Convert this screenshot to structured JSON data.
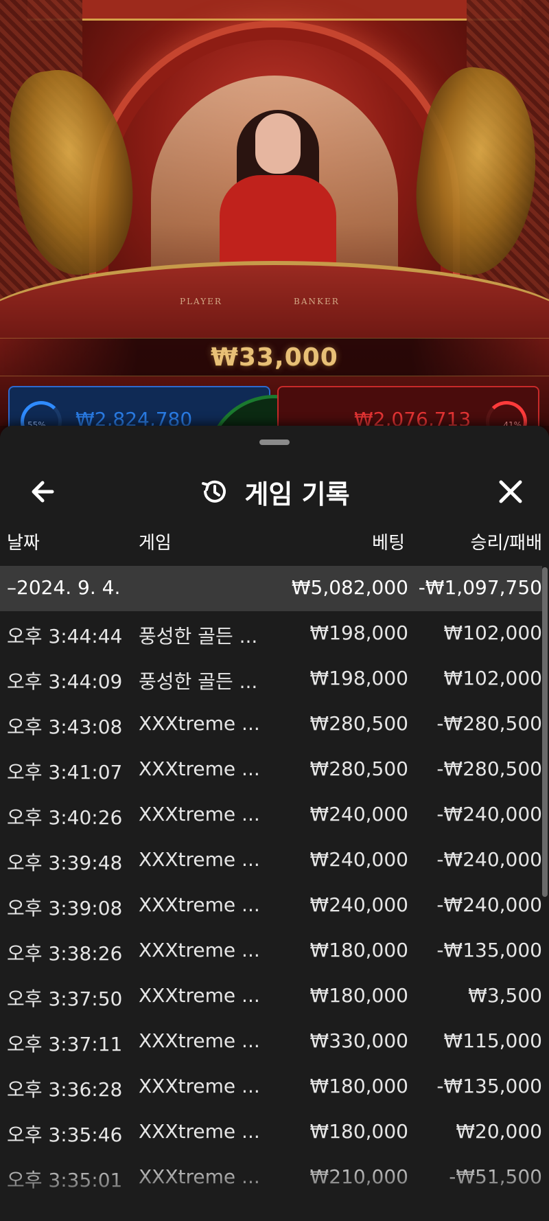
{
  "live": {
    "table_player_label": "PLAYER",
    "table_banker_label": "BANKER",
    "jackpot_amount": "₩33,000",
    "player_total": "₩2,824,780",
    "player_pct": "55%",
    "banker_total": "₩2,076,713",
    "banker_pct": "41%"
  },
  "sheet": {
    "title": "게임 기록",
    "back_icon": "arrow-left-icon",
    "close_icon": "close-icon",
    "title_icon": "history-icon",
    "columns": {
      "date": "날짜",
      "game": "게임",
      "bet": "베팅",
      "winloss": "승리/패배"
    },
    "summary": {
      "date": "–2024. 9. 4.",
      "bet": "₩5,082,000",
      "winloss": "-₩1,097,750"
    },
    "rows": [
      {
        "time": "오후 3:44:44",
        "game": "풍성한 골든 ...",
        "bet": "₩198,000",
        "winloss": "₩102,000"
      },
      {
        "time": "오후 3:44:09",
        "game": "풍성한 골든 ...",
        "bet": "₩198,000",
        "winloss": "₩102,000"
      },
      {
        "time": "오후 3:43:08",
        "game": "XXXtreme ...",
        "bet": "₩280,500",
        "winloss": "-₩280,500"
      },
      {
        "time": "오후 3:41:07",
        "game": "XXXtreme ...",
        "bet": "₩280,500",
        "winloss": "-₩280,500"
      },
      {
        "time": "오후 3:40:26",
        "game": "XXXtreme ...",
        "bet": "₩240,000",
        "winloss": "-₩240,000"
      },
      {
        "time": "오후 3:39:48",
        "game": "XXXtreme ...",
        "bet": "₩240,000",
        "winloss": "-₩240,000"
      },
      {
        "time": "오후 3:39:08",
        "game": "XXXtreme ...",
        "bet": "₩240,000",
        "winloss": "-₩240,000"
      },
      {
        "time": "오후 3:38:26",
        "game": "XXXtreme ...",
        "bet": "₩180,000",
        "winloss": "-₩135,000"
      },
      {
        "time": "오후 3:37:50",
        "game": "XXXtreme ...",
        "bet": "₩180,000",
        "winloss": "₩3,500"
      },
      {
        "time": "오후 3:37:11",
        "game": "XXXtreme ...",
        "bet": "₩330,000",
        "winloss": "₩115,000"
      },
      {
        "time": "오후 3:36:28",
        "game": "XXXtreme ...",
        "bet": "₩180,000",
        "winloss": "-₩135,000"
      },
      {
        "time": "오후 3:35:46",
        "game": "XXXtreme ...",
        "bet": "₩180,000",
        "winloss": "₩20,000"
      },
      {
        "time": "오후 3:35:01",
        "game": "XXXtreme ...",
        "bet": "₩210,000",
        "winloss": "-₩51,500"
      }
    ]
  },
  "colors": {
    "sheet_bg": "#1c1c1c",
    "summary_row_bg": "#3a3a3a",
    "jackpot_gold": "#e8c077",
    "player_blue": "#2f8bff",
    "banker_red": "#ff3b3b"
  }
}
